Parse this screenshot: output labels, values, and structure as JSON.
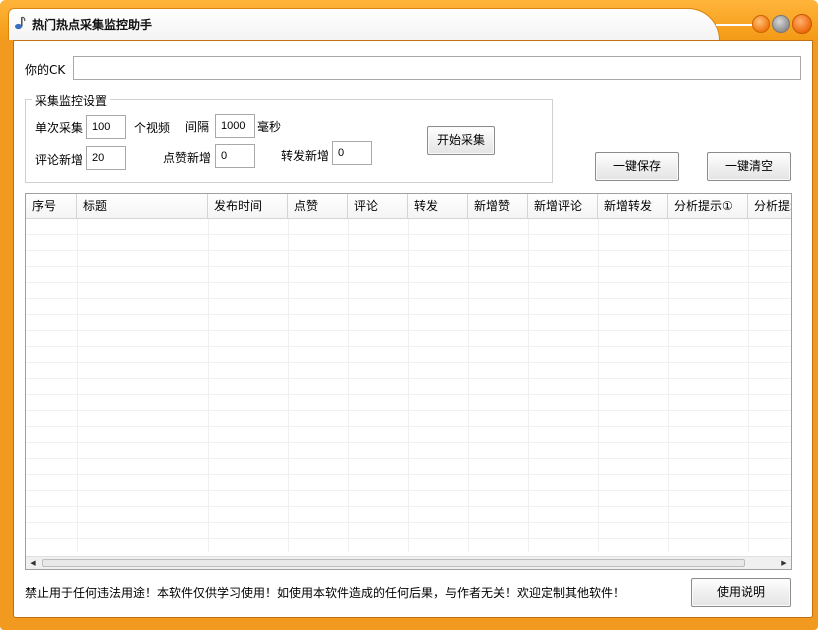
{
  "window": {
    "title": "热门热点采集监控助手",
    "accent_color": "#f29a20"
  },
  "ck": {
    "label": "你的CK",
    "value": ""
  },
  "settings": {
    "group_title": "采集监控设置",
    "single_collect_label": "单次采集",
    "single_collect_value": "100",
    "video_unit": "个视频",
    "interval_label": "间隔",
    "interval_value": "1000",
    "interval_unit": "毫秒",
    "comment_new_label": "评论新增",
    "comment_new_value": "20",
    "like_new_label": "点赞新增",
    "like_new_value": "0",
    "share_new_label": "转发新增",
    "share_new_value": "0",
    "start_button": "开始采集"
  },
  "actions": {
    "save_button": "一键保存",
    "clear_button": "一键清空"
  },
  "table": {
    "columns": [
      "序号",
      "标题",
      "发布时间",
      "点赞",
      "评论",
      "转发",
      "新增赞",
      "新增评论",
      "新增转发",
      "分析提示①",
      "分析提示"
    ],
    "rows": []
  },
  "footer": {
    "notice": "禁止用于任何违法用途！本软件仅供学习使用！如使用本软件造成的任何后果，与作者无关！欢迎定制其他软件！",
    "help_button": "使用说明"
  }
}
